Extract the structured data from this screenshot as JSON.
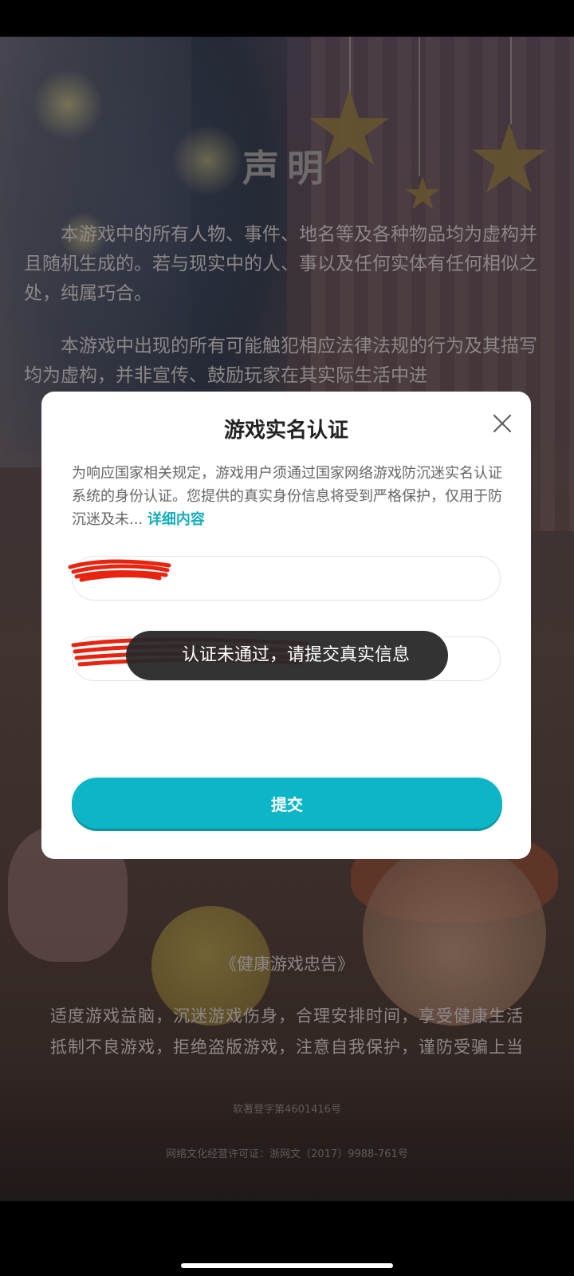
{
  "background": {
    "declaration_title": "声明",
    "paragraphs": [
      "本游戏中的所有人物、事件、地名等及各种物品均为虚构并且随机生成的。若与现实中的人、事以及任何实体有任何相似之处，纯属巧合。",
      "本游戏中出现的所有可能触犯相应法律法规的行为及其描写均为虚构，并非宣传、鼓励玩家在其实际生活中进"
    ],
    "health_title": "《健康游戏忠告》",
    "health_lines": [
      "适度游戏益脑，沉迷游戏伤身，合理安排时间，享受健康生活",
      "抵制不良游戏，拒绝盗版游戏，注意自我保护，谨防受骗上当"
    ],
    "footer": {
      "software_copyright": "软著登字第4601416号",
      "culture_license": "网络文化经营许可证：浙网文〔2017〕9988-761号"
    }
  },
  "dialog": {
    "title": "游戏实名认证",
    "description": "为响应国家相关规定，游戏用户须通过国家网络游戏防沉迷实名认证系统的身份认证。您提供的真实身份信息将受到严格保护，仅用于防沉迷及未...",
    "detail_link": "详细内容",
    "name_field": {
      "value": "",
      "redacted": true
    },
    "id_field": {
      "value": "",
      "redacted": true
    },
    "submit_label": "提交"
  },
  "toast": {
    "text": "认证未通过，请提交真实信息"
  },
  "colors": {
    "accent": "#0cb6c6",
    "link": "#12aebc",
    "toast_bg": "#282828",
    "redaction": "#e8230f"
  }
}
